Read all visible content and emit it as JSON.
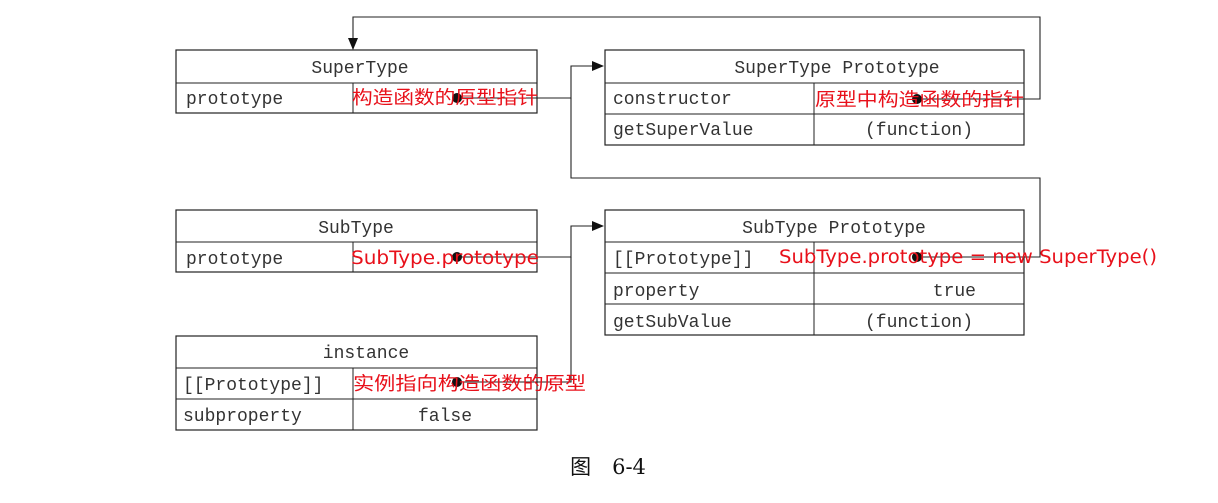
{
  "boxes": {
    "supertype": {
      "title": "SuperType",
      "rows": [
        [
          "prototype",
          ""
        ]
      ]
    },
    "supertype_proto": {
      "title": "SuperType Prototype",
      "rows": [
        [
          "constructor",
          ""
        ],
        [
          "getSuperValue",
          "(function)"
        ]
      ]
    },
    "subtype": {
      "title": "SubType",
      "rows": [
        [
          "prototype",
          ""
        ]
      ]
    },
    "subtype_proto": {
      "title": "SubType Prototype",
      "rows": [
        [
          "[[Prototype]]",
          ""
        ],
        [
          "property",
          "true"
        ],
        [
          "getSubValue",
          "(function)"
        ]
      ]
    },
    "instance": {
      "title": "instance",
      "rows": [
        [
          "[[Prototype]]",
          ""
        ],
        [
          "subproperty",
          "false"
        ]
      ]
    }
  },
  "annotations": {
    "supertype_prototype": "构造函数的原型指针",
    "proto_constructor": "原型中构造函数的指针",
    "subtype_prototype": "SubType.prototype",
    "subproto_prototype": "SubType.prototype = new SuperType()",
    "instance_prototype": "实例指向构造函数的原型"
  },
  "caption": "图　6-4",
  "colors": {
    "annotation": "#e8101a",
    "line": "#222222",
    "text": "#333333"
  }
}
